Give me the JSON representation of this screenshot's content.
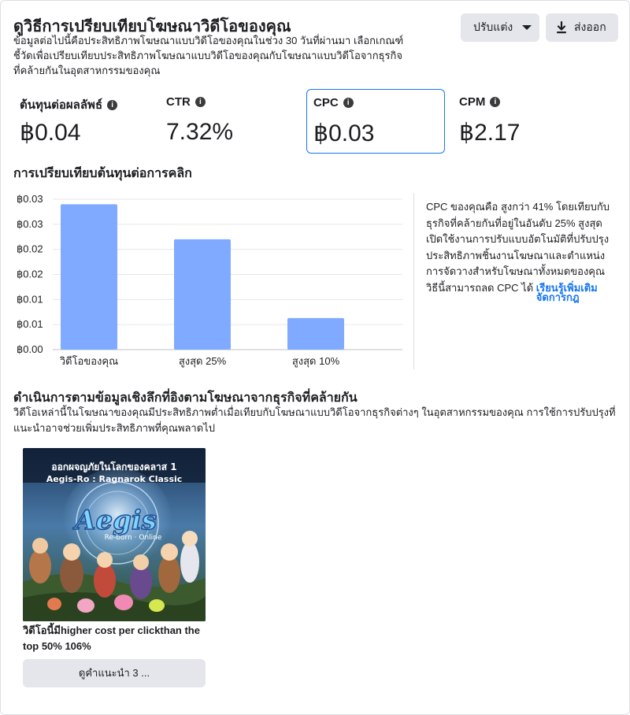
{
  "header": {
    "title": "ดูวิธีการเปรียบเทียบโฆษณาวิดีโอของคุณ",
    "description": "ข้อมูลต่อไปนี้คือประสิทธิภาพโฆษณาแบบวิดีโอของคุณในช่วง 30 วันที่ผ่านมา เลือกเกณฑ์ชี้วัดเพื่อเปรียบเทียบประสิทธิภาพโฆษณาแบบวิดีโอของคุณกับโฆษณาแบบวิดีโอจากธุรกิจที่คล้ายกันในอุตสาหกรรมของคุณ",
    "customize_label": "ปรับแต่ง",
    "export_label": "ส่งออก"
  },
  "metrics": [
    {
      "label": "ต้นทุนต่อผลลัพธ์",
      "value": "฿0.04",
      "selected": false
    },
    {
      "label": "CTR",
      "value": "7.32%",
      "selected": false
    },
    {
      "label": "CPC",
      "value": "฿0.03",
      "selected": true
    },
    {
      "label": "CPM",
      "value": "฿2.17",
      "selected": false
    }
  ],
  "comparison": {
    "title": "การเปรียบเทียบต้นทุนต่อการคลิก"
  },
  "chart_data": {
    "type": "bar",
    "categories": [
      "วิดีโอของคุณ",
      "สูงสุด 25%",
      "สูงสุด 10%"
    ],
    "values": [
      0.029,
      0.022,
      0.0063
    ],
    "ylim": [
      0,
      0.03
    ],
    "yticks": [
      "฿0.03",
      "฿0.03",
      "฿0.02",
      "฿0.02",
      "฿0.01",
      "฿0.01",
      "฿0.00"
    ],
    "bar_color": "#80aaff",
    "grid": true,
    "title": "",
    "xlabel": "",
    "ylabel": ""
  },
  "insight": {
    "text": "CPC ของคุณคือ สูงกว่า 41% โดยเทียบกับธุรกิจที่คล้ายกันที่อยู่ในอันดับ 25% สูงสุด เปิดใช้งานการปรับแบบอัตโนมัติที่ปรับปรุงประสิทธิภาพชิ้นงานโฆษณาและตำแหน่งการจัดวางสำหรับโฆษณาทั้งหมดของคุณ วิธีนี้สามารถลด CPC ได้",
    "link_label": "เรียนรู้เพิ่มเติม",
    "link_overlay": "จัดการกฎ"
  },
  "insights_section": {
    "title": "ดำเนินการตามข้อมูลเชิงลึกที่อิงตามโฆษณาจากธุรกิจที่คล้ายกัน",
    "description": "วิดีโอเหล่านี้ในโฆษณาของคุณมีประสิทธิภาพต่ำเมื่อเทียบกับโฆษณาแบบวิดีโอจากธุรกิจต่างๆ ในอุตสาหกรรมของคุณ การใช้การปรับปรุงที่แนะนำอาจช่วยเพิ่มประสิทธิภาพที่คุณพลาดไป"
  },
  "ad": {
    "image_title_line1": "ออกผจญภัยในโลกของคลาส 1",
    "image_title_line2": "Aegis-Ro : Ragnarok Classic",
    "logo_text": "Aegis",
    "logo_sub": "Re-born · Online",
    "caption": "วิดีโอนี้มีhigher cost per clickthan the top 50% 106%",
    "recommendations_label": "ดูคำแนะนำ 3 ..."
  },
  "colors": {
    "accent": "#1877f2",
    "button_bg": "#e4e6eb",
    "bar": "#80aaff"
  }
}
